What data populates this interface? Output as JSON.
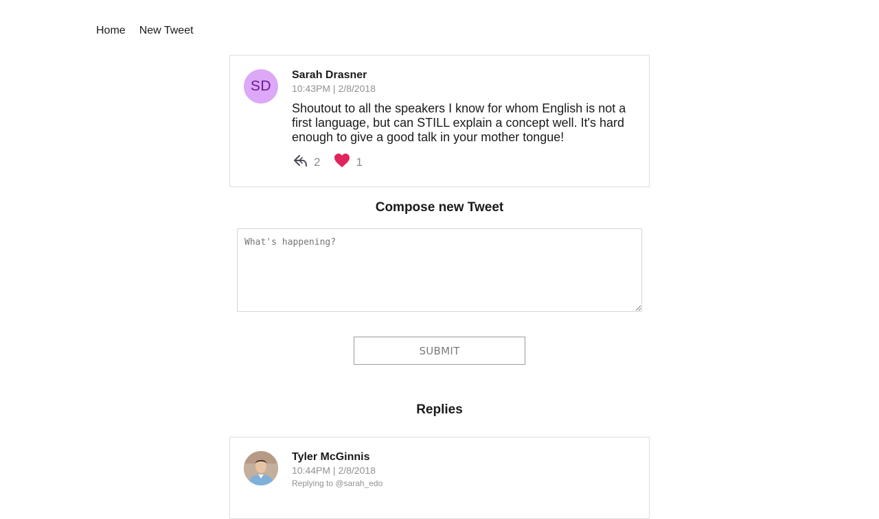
{
  "nav": {
    "home": "Home",
    "new_tweet": "New Tweet"
  },
  "tweet": {
    "avatar_initials": "SD",
    "author": "Sarah Drasner",
    "timestamp": "10:43PM | 2/8/2018",
    "text": "Shoutout to all the speakers I know for whom English is not a first language, but can STILL explain a concept well. It's hard enough to give a good talk in your mother tongue!",
    "reply_icon": "reply-arrow-icon",
    "reply_count": "2",
    "like_icon": "heart-filled-icon",
    "like_count": "1",
    "like_color": "#e0245e"
  },
  "compose": {
    "title": "Compose new Tweet",
    "placeholder": "What's happening?",
    "submit_label": "SUBMIT"
  },
  "replies": {
    "title": "Replies",
    "items": [
      {
        "author": "Tyler McGinnis",
        "timestamp": "10:44PM | 2/8/2018",
        "replying_to": "Replying to @sarah_edo"
      }
    ]
  },
  "colors": {
    "avatar_bg": "#dca8f7",
    "avatar_text": "#6a1a9a",
    "muted_text": "#909090"
  }
}
